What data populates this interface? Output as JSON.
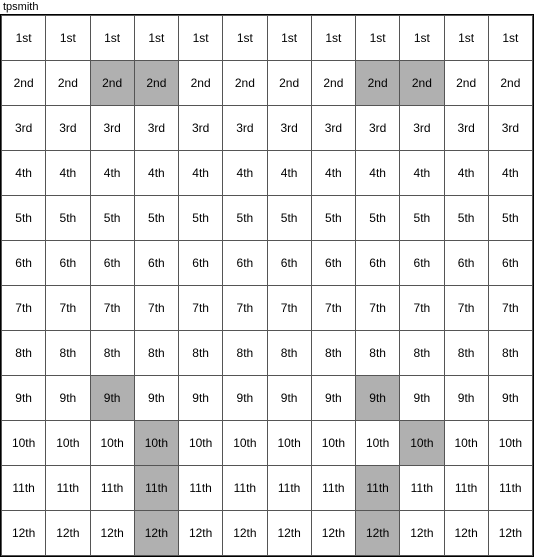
{
  "title": "tpsmith",
  "cols": 12,
  "rows": 12,
  "labels": [
    "1st",
    "2nd",
    "3rd",
    "4th",
    "5th",
    "6th",
    "7th",
    "8th",
    "9th",
    "10th",
    "11th",
    "12th"
  ],
  "highlights": {
    "1_2": false,
    "1_3": false,
    "2_2": true,
    "2_3": true,
    "2_8": true,
    "2_9": true,
    "2_10": true,
    "3_0": false,
    "5_0": false,
    "8_2": true,
    "8_8": true,
    "9_3": true,
    "9_9": true,
    "10_3": true,
    "10_8": true,
    "11_3": true,
    "11_8": true,
    "12_4": true,
    "12_5": true,
    "12_6": true,
    "12_7": true
  },
  "cell_highlights": [
    [
      0,
      0,
      0,
      0,
      0,
      0,
      0,
      0,
      0,
      0,
      0,
      0
    ],
    [
      0,
      0,
      1,
      1,
      0,
      0,
      0,
      0,
      1,
      1,
      0,
      0
    ],
    [
      0,
      0,
      0,
      0,
      0,
      0,
      0,
      0,
      0,
      0,
      0,
      0
    ],
    [
      0,
      0,
      0,
      0,
      0,
      0,
      0,
      0,
      0,
      0,
      0,
      0
    ],
    [
      0,
      0,
      0,
      0,
      0,
      0,
      0,
      0,
      0,
      0,
      0,
      0
    ],
    [
      0,
      0,
      0,
      0,
      0,
      0,
      0,
      0,
      0,
      0,
      0,
      0
    ],
    [
      0,
      0,
      0,
      0,
      0,
      0,
      0,
      0,
      0,
      0,
      0,
      0
    ],
    [
      0,
      0,
      0,
      0,
      0,
      0,
      0,
      0,
      0,
      0,
      0,
      0
    ],
    [
      0,
      0,
      1,
      0,
      0,
      0,
      0,
      0,
      1,
      0,
      0,
      0
    ],
    [
      0,
      0,
      0,
      1,
      0,
      0,
      0,
      0,
      0,
      1,
      0,
      0
    ],
    [
      0,
      0,
      0,
      1,
      0,
      0,
      0,
      0,
      1,
      0,
      0,
      0
    ],
    [
      0,
      0,
      0,
      1,
      0,
      0,
      0,
      0,
      1,
      0,
      0,
      0
    ],
    [
      0,
      0,
      0,
      0,
      1,
      1,
      1,
      1,
      0,
      0,
      0,
      0
    ]
  ]
}
